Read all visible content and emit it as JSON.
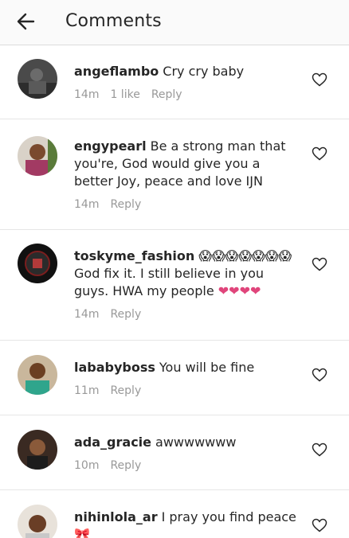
{
  "header": {
    "title": "Comments"
  },
  "comments": [
    {
      "user": "angeflambo",
      "text": "Cry cry baby",
      "time": "14m",
      "likes": "1 like",
      "reply": "Reply"
    },
    {
      "user": "engypearl",
      "text": "Be a strong man that you're, God would give you a better Joy, peace and love IJN",
      "time": "14m",
      "reply": "Reply"
    },
    {
      "user": "toskyme_fashion",
      "text_emoji": "😱😱😱😱😱😱😱",
      "text": "God fix it. I still believe in you guys. HWA my people",
      "text_hearts": "❤❤❤❤",
      "time": "14m",
      "reply": "Reply"
    },
    {
      "user": "lababyboss",
      "text": "You will be fine",
      "time": "11m",
      "reply": "Reply"
    },
    {
      "user": "ada_gracie",
      "text": "awwwwwww",
      "time": "10m",
      "reply": "Reply"
    },
    {
      "user": "nihinlola_ar",
      "text": "I pray you find peace",
      "text_emoji": "🎀",
      "time": "",
      "reply": ""
    }
  ],
  "icons": {
    "back": "arrow-left-icon",
    "like": "heart-outline-icon"
  },
  "colors": {
    "meta": "#999999",
    "text": "#262626",
    "divider": "#e6e6e6",
    "heart_emoji": "#e0457b"
  }
}
